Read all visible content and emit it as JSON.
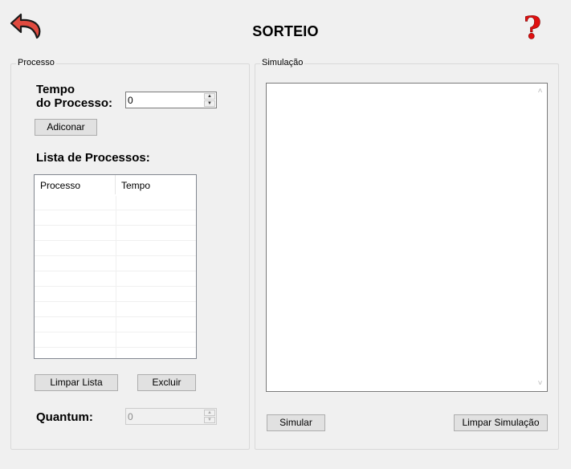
{
  "window": {
    "title": "SORTEIO"
  },
  "processo": {
    "group_label": "Processo",
    "tempo_label_line1": "Tempo",
    "tempo_label_line2": "do Processo:",
    "tempo_value": "0",
    "add_button": "Adiconar",
    "list_title": "Lista de Processos:",
    "list_columns": [
      "Processo",
      "Tempo"
    ],
    "list_rows": [],
    "clear_button": "Limpar Lista",
    "delete_button": "Excluir",
    "quantum_label": "Quantum:",
    "quantum_value": "0"
  },
  "simulacao": {
    "group_label": "Simulação",
    "output_text": "",
    "simulate_button": "Simular",
    "clear_button": "Limpar Simulação"
  },
  "icons": {
    "back": "back-arrow-icon",
    "help": "question-mark-icon"
  },
  "colors": {
    "back_icon": "#e04a3f",
    "help_icon": "#e01010"
  }
}
